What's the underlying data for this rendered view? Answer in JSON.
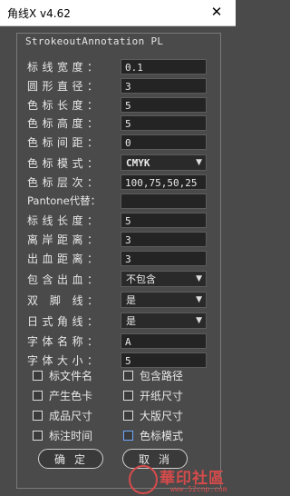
{
  "window": {
    "title": "角线X v4.62",
    "close_glyph": "✕"
  },
  "panel": {
    "title": "StrokeoutAnnotation PL"
  },
  "fields": [
    {
      "label": "标线宽度：",
      "value": "0.1"
    },
    {
      "label": "圆形直径：",
      "value": "3"
    },
    {
      "label": "色标长度：",
      "value": "5"
    },
    {
      "label": "色标高度：",
      "value": "5"
    },
    {
      "label": "色标间距：",
      "value": "0"
    },
    {
      "label": "色标模式：",
      "value": "CMYK",
      "type": "select"
    },
    {
      "label": "色标层次：",
      "value": "100,75,50,25"
    },
    {
      "label": "Pantone代替：",
      "value": ""
    },
    {
      "label": "标线长度：",
      "value": "5"
    },
    {
      "label": "离岸距离：",
      "value": "3"
    },
    {
      "label": "出血距离：",
      "value": "3"
    },
    {
      "label": "包含出血：",
      "value": "不包含",
      "type": "select"
    },
    {
      "label": "双 脚 线：",
      "value": "是",
      "type": "select"
    },
    {
      "label": "日式角线：",
      "value": "是",
      "type": "select"
    },
    {
      "label": "字体名称：",
      "value": "A"
    },
    {
      "label": "字体大小：",
      "value": "5"
    }
  ],
  "checkboxes": [
    {
      "label": "标文件名",
      "checked": false
    },
    {
      "label": "包含路径",
      "checked": false
    },
    {
      "label": "产生色卡",
      "checked": false
    },
    {
      "label": "开纸尺寸",
      "checked": false
    },
    {
      "label": "成品尺寸",
      "checked": false
    },
    {
      "label": "大版尺寸",
      "checked": false
    },
    {
      "label": "标注时间",
      "checked": false
    },
    {
      "label": "色标模式",
      "checked": false,
      "focused": true
    }
  ],
  "buttons": {
    "ok": "确定",
    "cancel": "取消"
  },
  "watermark": {
    "text": "華印社區",
    "url": "www.52cnp.com"
  },
  "colors": {
    "background": "#4a4a4a",
    "field_bg": "#242424",
    "watermark": "#d64b4b",
    "focus": "#6fa8ff"
  }
}
